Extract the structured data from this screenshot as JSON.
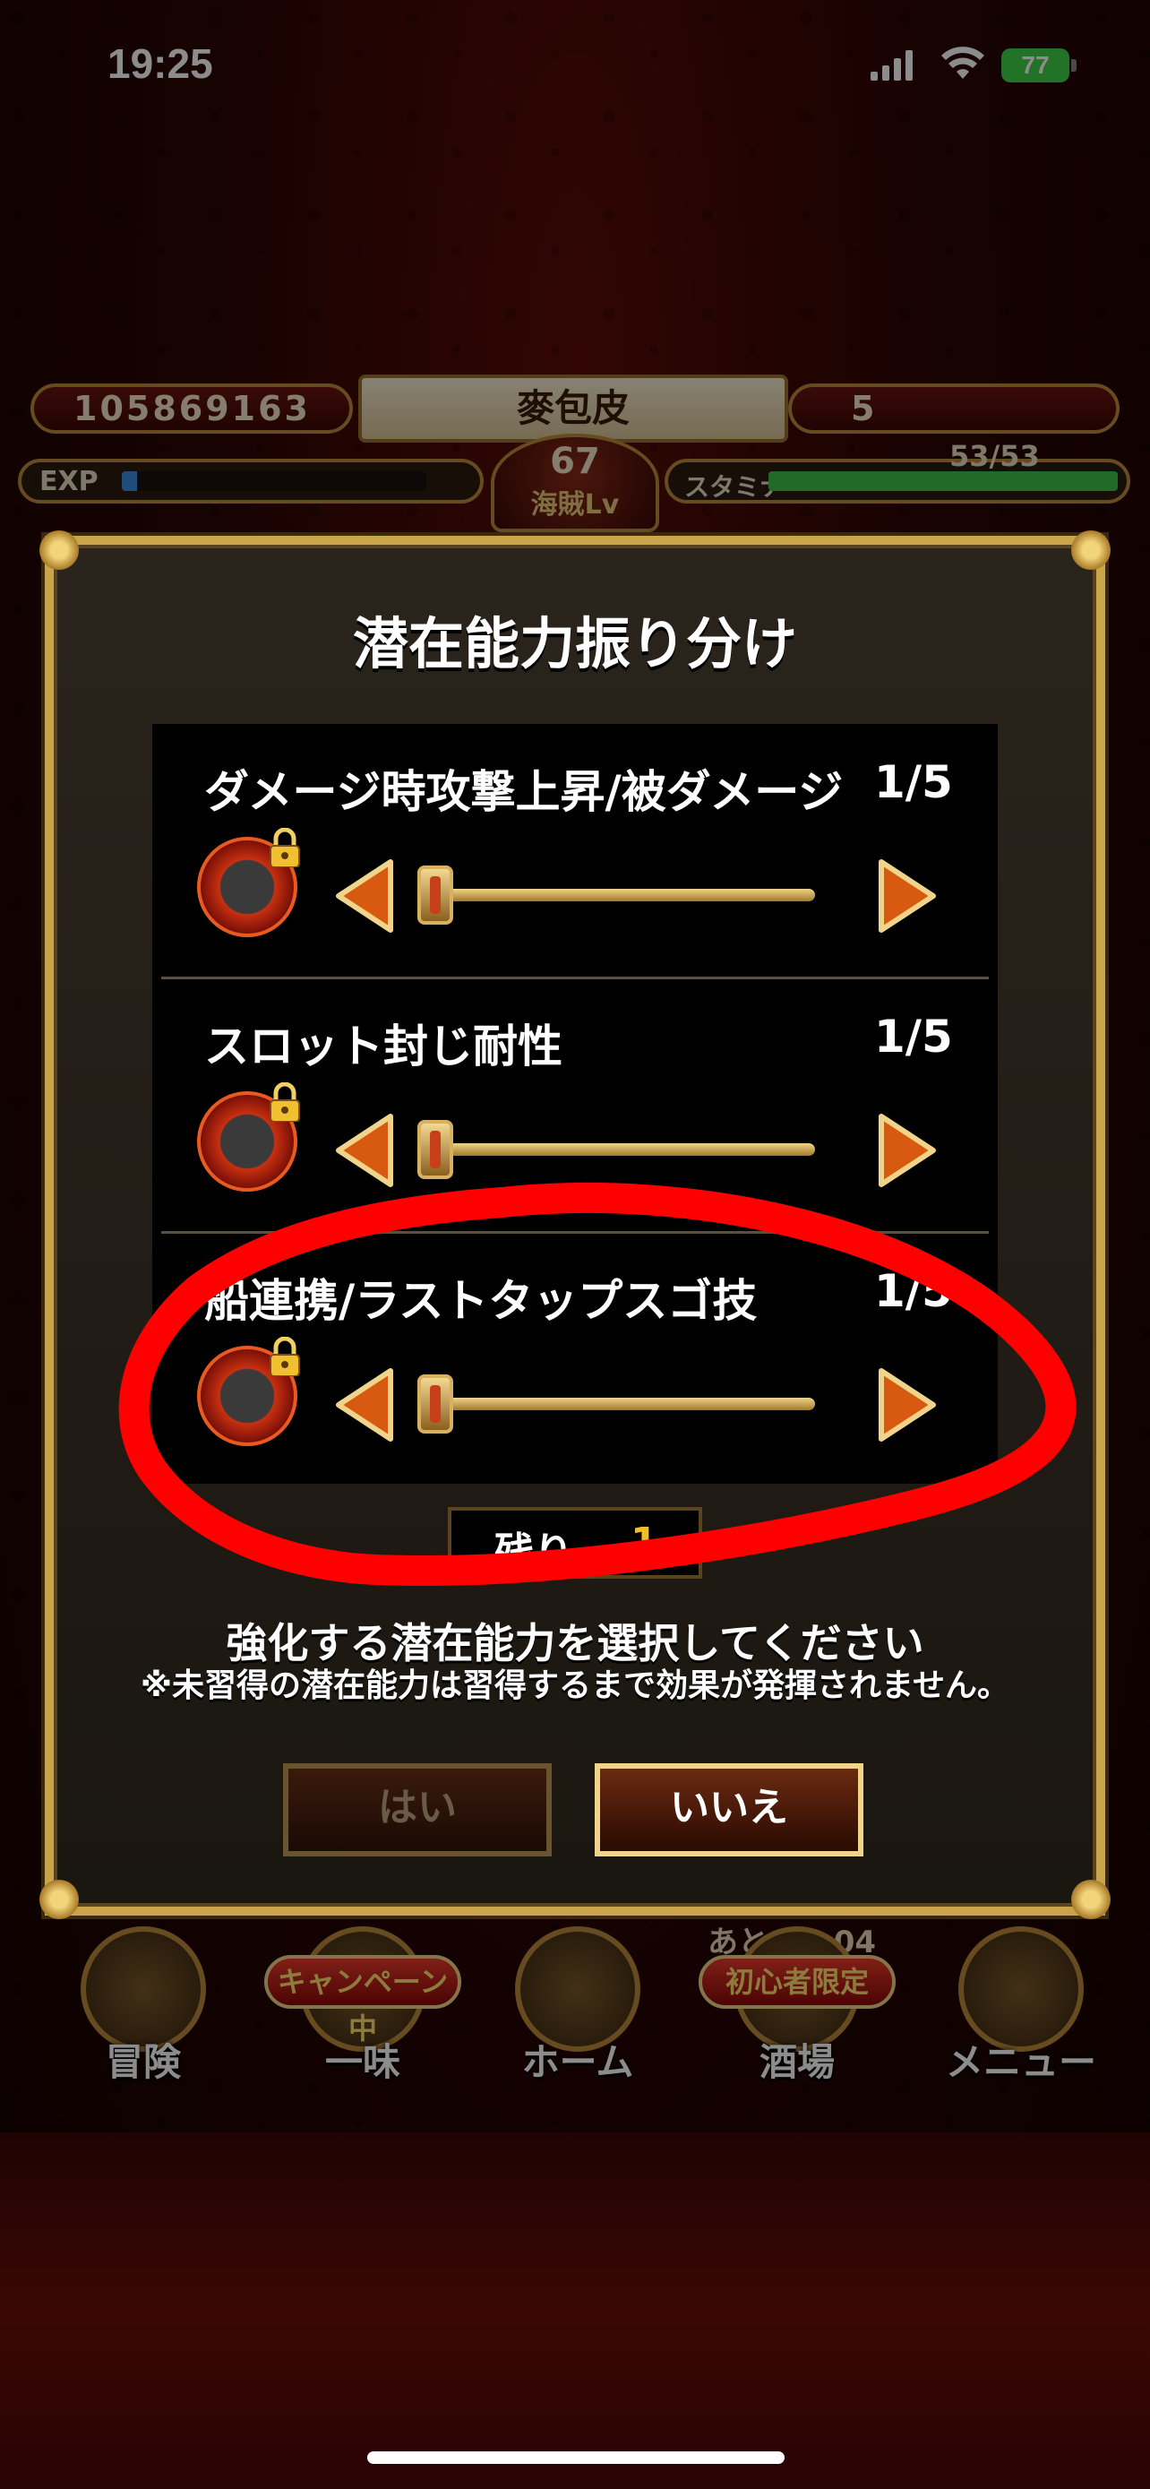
{
  "status_bar": {
    "time": "19:25",
    "battery": "77"
  },
  "header": {
    "berry_count": "105869163",
    "player_name": "麥包皮",
    "gem_count": "5",
    "exp_label": "EXP",
    "exp_progress": 0.05,
    "stamina_label": "スタミナ",
    "stamina_value": "53/53",
    "stamina_progress": 1.0,
    "level": "67",
    "level_label": "海賊Lv"
  },
  "dialog": {
    "title": "潜在能力振り分け",
    "abilities": [
      {
        "label": "ダメージ時攻撃上昇/被ダメージ",
        "count": "1/5",
        "icon": "attack-up-lock-icon"
      },
      {
        "label": "スロット封じ耐性",
        "count": "1/5",
        "icon": "slot-seal-lock-icon"
      },
      {
        "label": "船連携/ラストタップスゴ技",
        "count": "1/5",
        "icon": "ship-link-lock-icon"
      }
    ],
    "remaining_label": "残り",
    "remaining_value": "1",
    "instruction": "強化する潜在能力を選択してください",
    "note": "※未習得の潜在能力は習得するまで効果が発揮されません。",
    "yes_label": "はい",
    "no_label": "いいえ"
  },
  "bottom_nav": {
    "timer": "あと 52:04",
    "items": [
      {
        "label": "冒険",
        "icon": "ship-wheel-icon"
      },
      {
        "label": "一味",
        "icon": "crew-icon",
        "badge": "キャンペーン中"
      },
      {
        "label": "ホーム",
        "icon": "home-ship-icon"
      },
      {
        "label": "酒場",
        "icon": "tavern-icon",
        "badge": "初心者限定"
      },
      {
        "label": "メニュー",
        "icon": "menu-scroll-icon"
      }
    ]
  },
  "colors": {
    "accent_gold": "#c9a44a",
    "annotation_red": "#ff0000",
    "remaining_yellow": "#f0c020"
  }
}
